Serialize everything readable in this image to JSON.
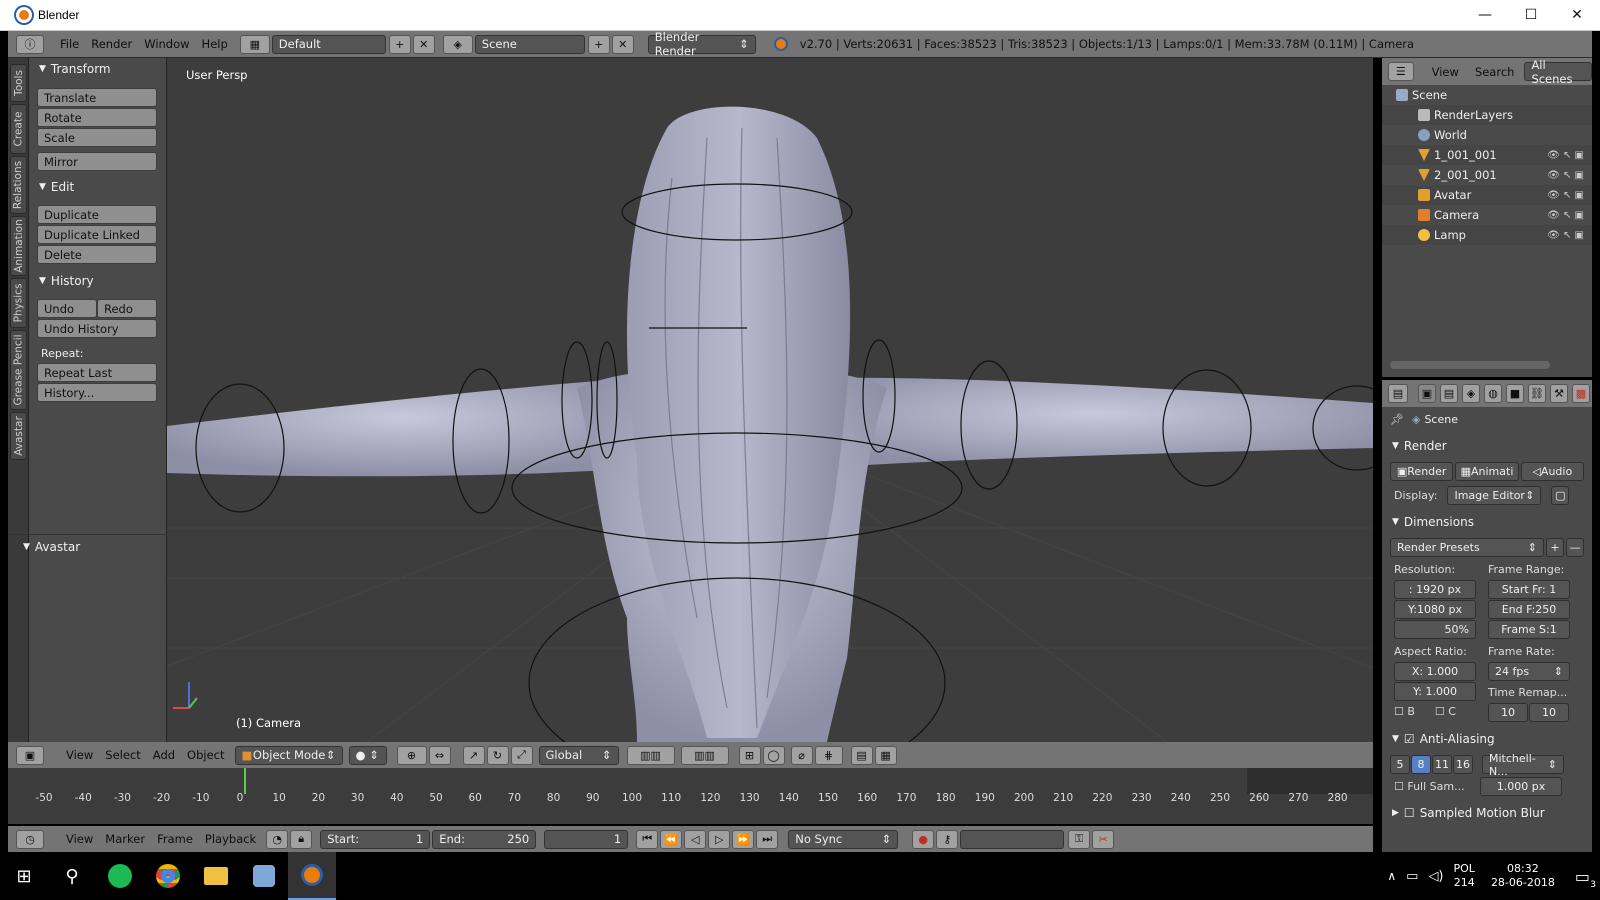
{
  "window": {
    "title": "Blender",
    "minimize": "—",
    "maximize": "☐",
    "close": "✕"
  },
  "info": {
    "menus": [
      "File",
      "Render",
      "Window",
      "Help"
    ],
    "layout": "Default",
    "scene": "Scene",
    "engine": "Blender Render",
    "stats": "v2.70 | Verts:20631 | Faces:38523 | Tris:38523 | Objects:1/13 | Lamps:0/1 | Mem:33.78M (0.11M) | Camera"
  },
  "tabs": [
    "Tools",
    "Create",
    "Relations",
    "Animation",
    "Physics",
    "Grease Pencil",
    "Avastar"
  ],
  "toolshelf": {
    "transform_title": "Transform",
    "translate": "Translate",
    "rotate": "Rotate",
    "scale": "Scale",
    "mirror": "Mirror",
    "edit_title": "Edit",
    "duplicate": "Duplicate",
    "duplicate_linked": "Duplicate Linked",
    "delete": "Delete",
    "history_title": "History",
    "undo": "Undo",
    "redo": "Redo",
    "undo_history": "Undo History",
    "repeat_label": "Repeat:",
    "repeat_last": "Repeat Last",
    "history_btn": "History...",
    "avastar_title": "Avastar"
  },
  "viewport": {
    "persp": "User Persp",
    "camera_label": "(1) Camera"
  },
  "vpheader": {
    "menus": [
      "View",
      "Select",
      "Add",
      "Object"
    ],
    "mode": "Object Mode",
    "orientation": "Global"
  },
  "timeline": {
    "ticks": [
      "-50",
      "-40",
      "-30",
      "-20",
      "-10",
      "0",
      "10",
      "20",
      "30",
      "40",
      "50",
      "60",
      "70",
      "80",
      "90",
      "100",
      "110",
      "120",
      "130",
      "140",
      "150",
      "160",
      "170",
      "180",
      "190",
      "200",
      "210",
      "220",
      "230",
      "240",
      "250",
      "260",
      "270",
      "280"
    ],
    "menus": [
      "View",
      "Marker",
      "Frame",
      "Playback"
    ],
    "start_label": "Start:",
    "start_value": "1",
    "end_label": "End:",
    "end_value": "250",
    "current": "1",
    "sync": "No Sync"
  },
  "outliner": {
    "menus": [
      "View",
      "Search",
      "All Scenes"
    ],
    "rows": [
      {
        "name": "Scene",
        "color": "#9aa9c4"
      },
      {
        "name": "RenderLayers",
        "color": "#bbbbbb"
      },
      {
        "name": "World",
        "color": "#8aa0c0"
      },
      {
        "name": "1_001_001",
        "color": "#e0a030"
      },
      {
        "name": "2_001_001",
        "color": "#e0a030"
      },
      {
        "name": "Avatar",
        "color": "#e0a030"
      },
      {
        "name": "Camera",
        "color": "#e07f30"
      },
      {
        "name": "Lamp",
        "color": "#f0c040"
      }
    ]
  },
  "props": {
    "scene": "Scene",
    "render_title": "Render",
    "render_btn": "Render",
    "anim_btn": "Animati",
    "audio_btn": "Audio",
    "display_label": "Display:",
    "display_value": "Image Editor",
    "dimensions_title": "Dimensions",
    "render_presets": "Render Presets",
    "resolution_label": "Resolution:",
    "frame_range_label": "Frame Range:",
    "res_x": ": 1920 px",
    "res_y": "Y:1080 px",
    "res_pct": "50%",
    "start_fr": "Start Fr: 1",
    "end_fr": "End F:250",
    "frame_s": "Frame S:1",
    "aspect_label": "Aspect Ratio:",
    "frame_rate_label": "Frame Rate:",
    "asp_x": "X:  1.000",
    "asp_y": "Y:  1.000",
    "fps": "24 fps",
    "time_remap": "Time Remap...",
    "b": "B",
    "c": "C",
    "remap_a": "10",
    "remap_b": "10",
    "aa_title": "Anti-Aliasing",
    "aa_5": "5",
    "aa_8": "8",
    "aa_11": "11",
    "aa_16": "16",
    "aa_filter": "Mitchell-N...",
    "full_sample": "Full Sam...",
    "filter_size": "1.000 px",
    "motion_blur": "Sampled Motion Blur"
  },
  "taskbar": {
    "lang": "POL",
    "lang2": "214",
    "time": "08:32",
    "date": "28-06-2018",
    "notif": "3"
  }
}
